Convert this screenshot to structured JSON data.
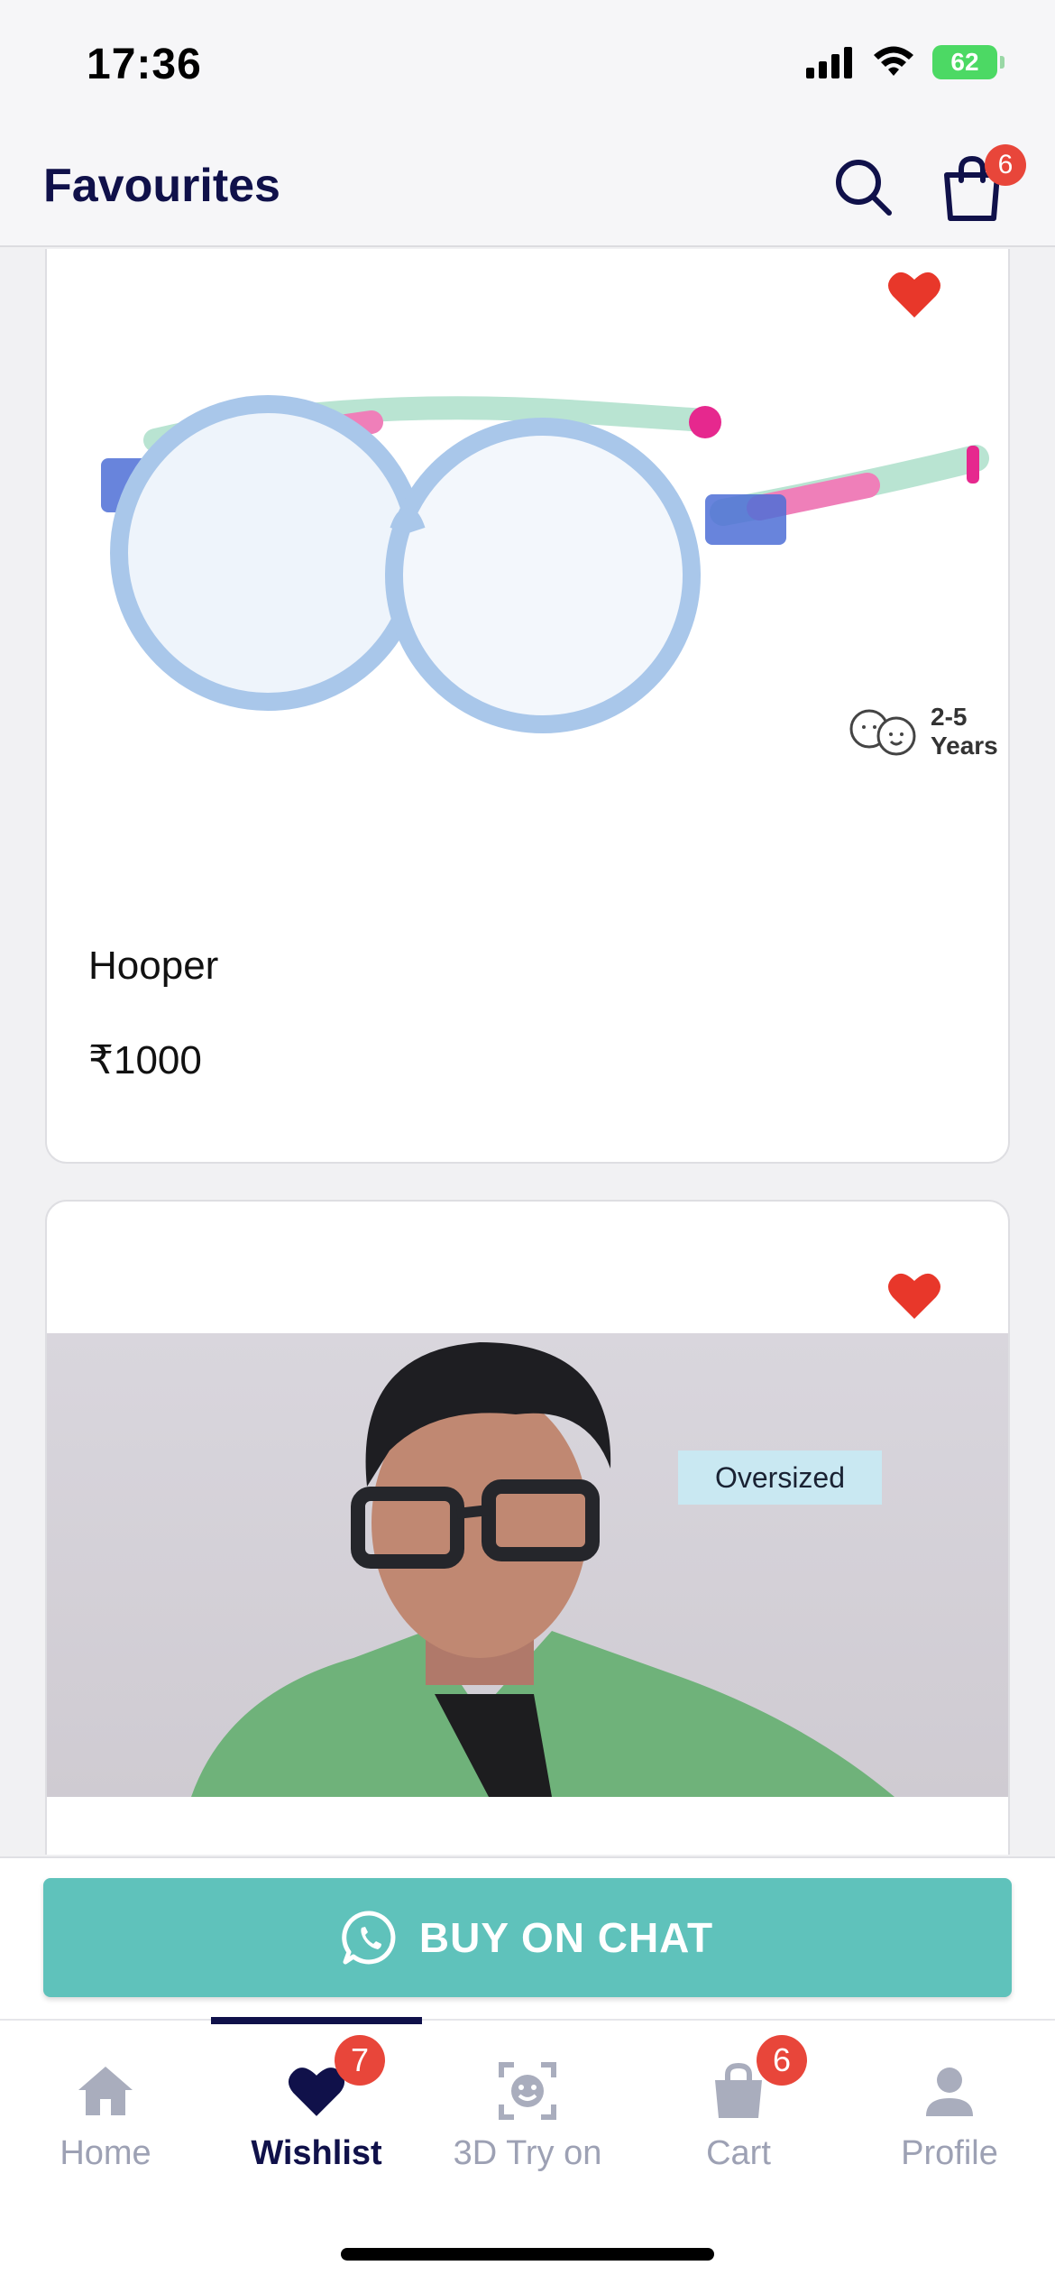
{
  "status_bar": {
    "time": "17:36",
    "battery": "62"
  },
  "header": {
    "title": "Favourites",
    "cart_count": "6"
  },
  "products": [
    {
      "name": "Hooper",
      "price": "₹1000",
      "age_range_top": "2-5",
      "age_range_bottom": "Years"
    },
    {
      "tag": "Oversized"
    }
  ],
  "chat": {
    "label": "BUY ON CHAT"
  },
  "nav": {
    "items": [
      {
        "label": "Home"
      },
      {
        "label": "Wishlist",
        "badge": "7"
      },
      {
        "label": "3D Try on"
      },
      {
        "label": "Cart",
        "badge": "6"
      },
      {
        "label": "Profile"
      }
    ],
    "active_index": 1
  },
  "colors": {
    "accent": "#5fc2bb",
    "brand": "#10114a",
    "badge": "#e8463a",
    "heart": "#e8372a"
  },
  "icons": [
    "search-icon",
    "bag-icon",
    "heart-icon",
    "whatsapp-icon",
    "home-icon",
    "face-scan-icon",
    "cart-icon",
    "profile-icon"
  ]
}
